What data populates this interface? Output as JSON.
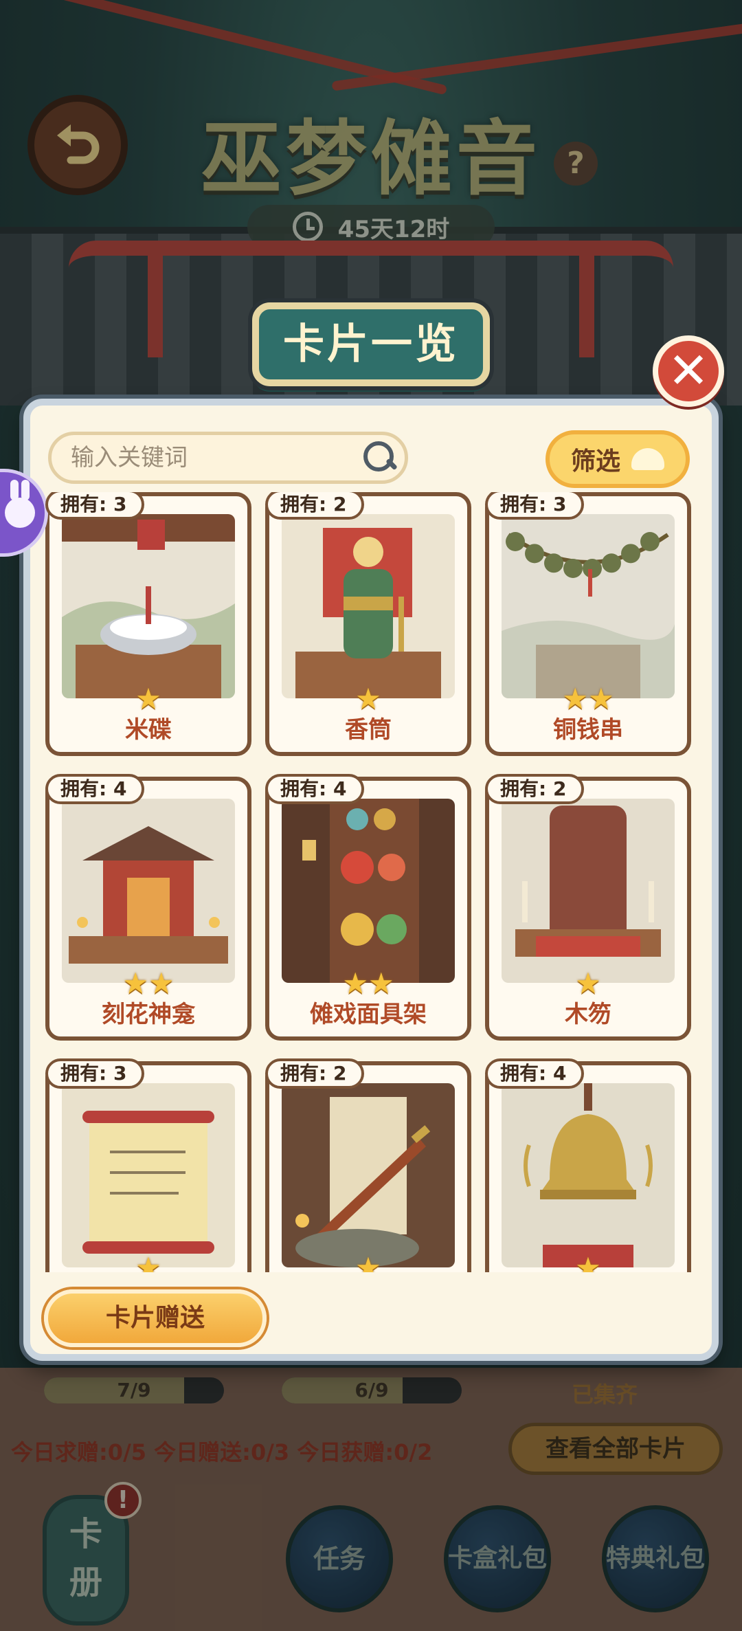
{
  "header": {
    "title": "巫梦傩音",
    "timer": "45天12时",
    "help": "?"
  },
  "modal": {
    "title": "卡片一览",
    "close": "✕",
    "search_placeholder": "输入关键词",
    "filter_label": "筛选",
    "gift_button": "卡片赠送",
    "cards": [
      {
        "owned": "拥有: 3",
        "name": "米碟",
        "stars": "★",
        "art": "rice-bowl"
      },
      {
        "owned": "拥有: 2",
        "name": "香筒",
        "stars": "★",
        "art": "incense-tube"
      },
      {
        "owned": "拥有: 3",
        "name": "铜钱串",
        "stars": "★★",
        "art": "coin-string"
      },
      {
        "owned": "拥有: 4",
        "name": "刻花神龛",
        "stars": "★★",
        "art": "shrine"
      },
      {
        "owned": "拥有: 4",
        "name": "傩戏面具架",
        "stars": "★★",
        "art": "mask-rack"
      },
      {
        "owned": "拥有: 2",
        "name": "木笏",
        "stars": "★",
        "art": "wooden-tablet"
      },
      {
        "owned": "拥有: 3",
        "name": "",
        "stars": "★",
        "art": "scroll"
      },
      {
        "owned": "拥有: 2",
        "name": "",
        "stars": "★",
        "art": "sword"
      },
      {
        "owned": "拥有: 4",
        "name": "",
        "stars": "★",
        "art": "bell"
      }
    ]
  },
  "bottom": {
    "progress": [
      {
        "text": "7/9",
        "fraction": 0.78
      },
      {
        "text": "6/9",
        "fraction": 0.67
      }
    ],
    "collected": "已集齐",
    "daily": "今日求赠:0/5 今日赠送:0/3 今日获赠:0/2",
    "view_all": "查看全部卡片",
    "album": "卡\n册",
    "alert": "!",
    "buttons": [
      "任务",
      "卡盒礼包",
      "特典礼包"
    ]
  },
  "colors": {
    "accent_teal": "#2f6f6a",
    "card_border": "#7a5336",
    "card_name": "#b04a27",
    "star": "#f6c23c",
    "close_red": "#d24a3a"
  },
  "icons": {
    "back": "back-arrow-icon",
    "search": "search-icon",
    "filter": "cloud-caret-icon",
    "clock": "clock-icon",
    "bunny": "bunny-icon"
  }
}
